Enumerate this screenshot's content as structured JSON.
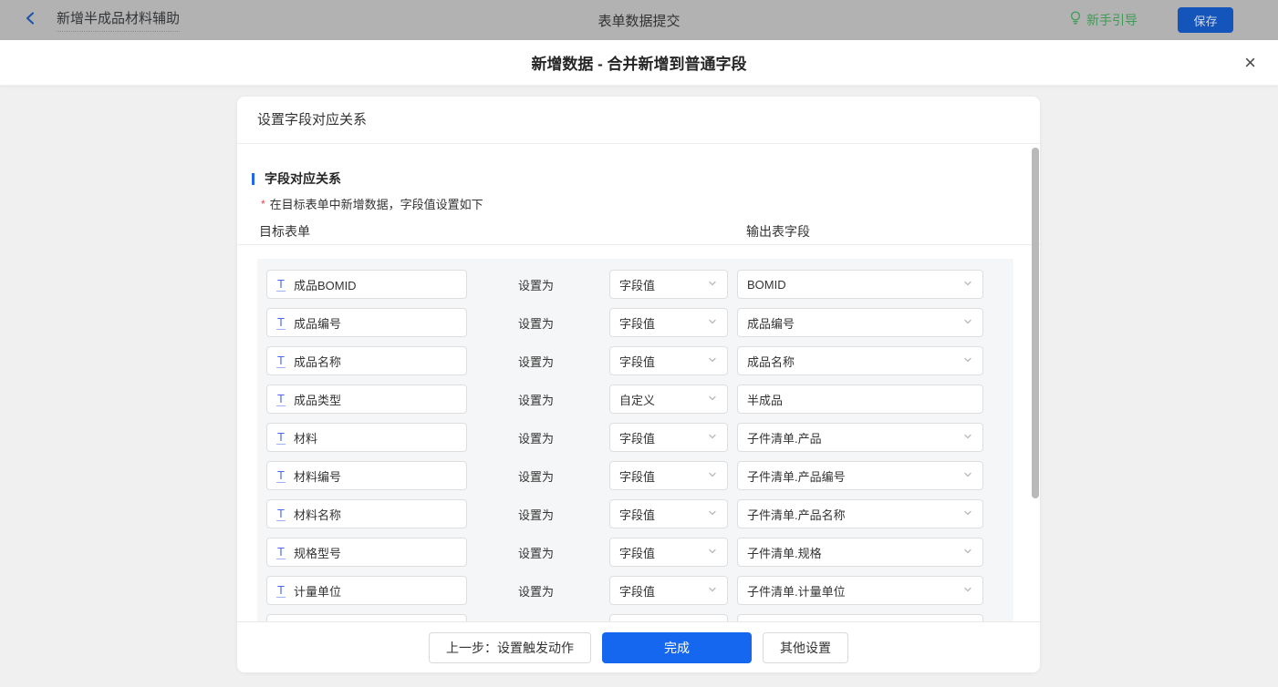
{
  "topbar": {
    "title": "新增半成品材料辅助",
    "center_title": "表单数据提交",
    "guide_label": "新手引导",
    "save_label": "保存"
  },
  "modal": {
    "title": "新增数据 - 合并新增到普通字段",
    "close_glyph": "×"
  },
  "panel": {
    "header": "设置字段对应关系",
    "section_title": "字段对应关系",
    "required_mark": "*",
    "description": "在目标表单中新增数据，字段值设置如下",
    "col_left": "目标表单",
    "col_right": "输出表字段",
    "set_as_label": "设置为"
  },
  "mappings": [
    {
      "target_field": "成品BOMID",
      "value_type": "字段值",
      "output_field": "BOMID",
      "output_is_dropdown": true
    },
    {
      "target_field": "成品编号",
      "value_type": "字段值",
      "output_field": "成品编号",
      "output_is_dropdown": true
    },
    {
      "target_field": "成品名称",
      "value_type": "字段值",
      "output_field": "成品名称",
      "output_is_dropdown": true
    },
    {
      "target_field": "成品类型",
      "value_type": "自定义",
      "output_field": "半成品",
      "output_is_dropdown": false
    },
    {
      "target_field": "材料",
      "value_type": "字段值",
      "output_field": "子件清单.产品",
      "output_is_dropdown": true
    },
    {
      "target_field": "材料编号",
      "value_type": "字段值",
      "output_field": "子件清单.产品编号",
      "output_is_dropdown": true
    },
    {
      "target_field": "材料名称",
      "value_type": "字段值",
      "output_field": "子件清单.产品名称",
      "output_is_dropdown": true
    },
    {
      "target_field": "规格型号",
      "value_type": "字段值",
      "output_field": "子件清单.规格",
      "output_is_dropdown": true
    },
    {
      "target_field": "计量单位",
      "value_type": "字段值",
      "output_field": "子件清单.计量单位",
      "output_is_dropdown": true
    },
    {
      "target_field": "",
      "value_type": "",
      "output_field": "",
      "output_is_dropdown": false,
      "partial": true
    }
  ],
  "footer": {
    "back_label": "上一步：设置触发动作",
    "primary_label": "完成",
    "other_label": "其他设置"
  },
  "colors": {
    "primary_blue": "#1667f0",
    "save_button_blue_dimmed": "#1355bb",
    "guide_green_dimmed": "#3f9b55",
    "field_icon_blue": "#4a6bf5",
    "section_bar_blue": "#2468f2",
    "required_red": "#f53f3f",
    "topbar_dimmed_bg": "#b2b2b2",
    "scrollbar_gray": "#b9b9b9"
  }
}
